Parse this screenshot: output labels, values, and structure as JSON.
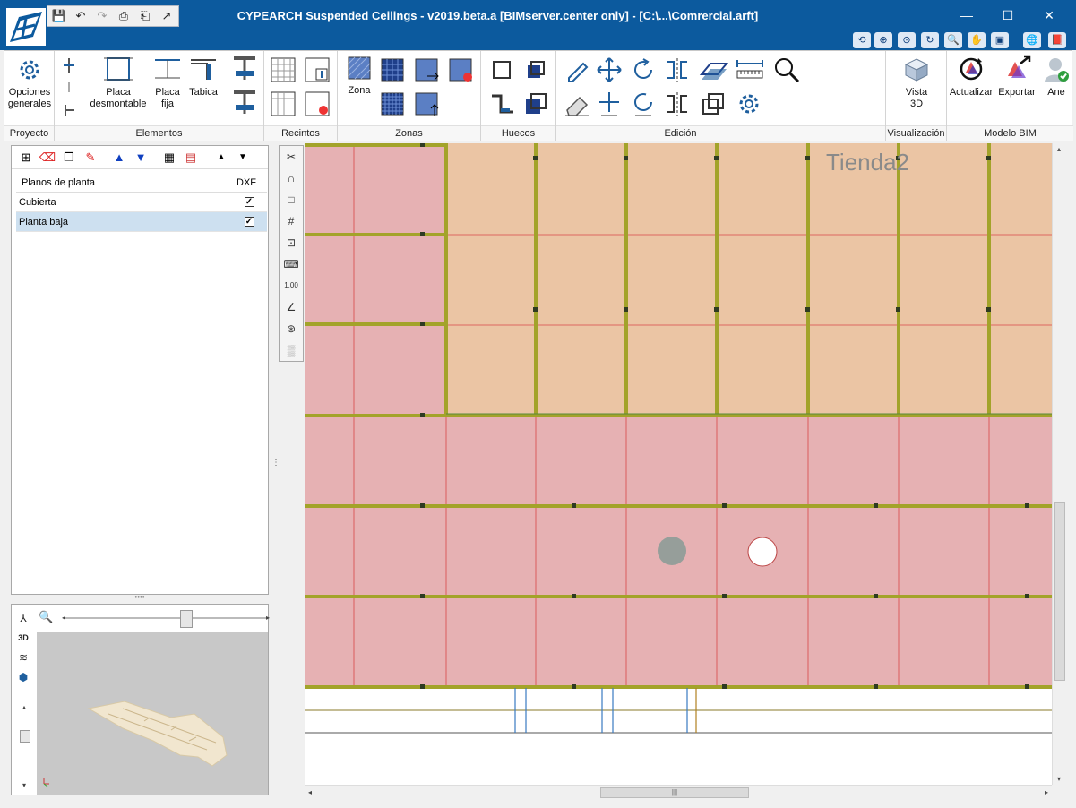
{
  "window": {
    "title": "CYPEARCH Suspended Ceilings - v2019.beta.a [BIMserver.center only] - [C:\\...\\Comrercial.arft]",
    "minimize": "—",
    "maximize": "☐",
    "close": "✕"
  },
  "ribbon": {
    "groups": {
      "proyecto": "Proyecto",
      "elementos": "Elementos",
      "recintos": "Recintos",
      "zonas": "Zonas",
      "huecos": "Huecos",
      "edicion": "Edición",
      "visualizacion": "Visualización",
      "modelo_bim": "Modelo BIM"
    },
    "buttons": {
      "opciones_line1": "Opciones",
      "opciones_line2": "generales",
      "placa_desmontable_line1": "Placa",
      "placa_desmontable_line2": "desmontable",
      "placa_fija_line1": "Placa",
      "placa_fija_line2": "fija",
      "tabica": "Tabica",
      "zona": "Zona",
      "vista3d_line1": "Vista",
      "vista3d_line2": "3D",
      "actualizar": "Actualizar",
      "exportar": "Exportar",
      "ane": "Ane"
    }
  },
  "left_panel": {
    "columns": [
      "Planos de planta",
      "DXF"
    ],
    "rows": [
      {
        "name": "Cubierta",
        "dxf": true,
        "selected": false
      },
      {
        "name": "Planta baja",
        "dxf": true,
        "selected": true
      }
    ]
  },
  "canvas": {
    "zone_label": "Tienda2",
    "colors": {
      "pink_zone": "#e6b1b3",
      "tan_zone": "#ebc5a4",
      "profile": "#a3a32a",
      "grid_line": "#d84848"
    }
  }
}
